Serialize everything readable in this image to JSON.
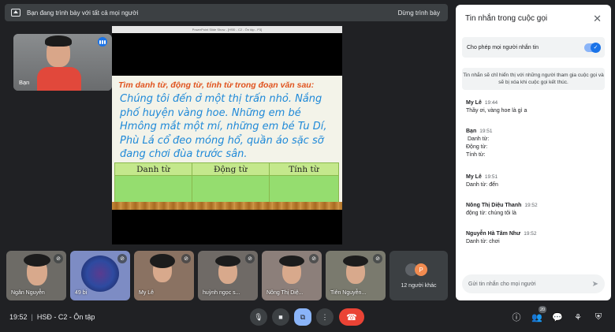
{
  "banner": {
    "text": "Bạn đang trình bày với tất cả mọi người",
    "stop_label": "Dừng trình bày"
  },
  "self_tile": {
    "name": "Bạn"
  },
  "presentation": {
    "window_title": "PowerPoint Slide Show - [HSĐ - C2 - Ôn tập - P3]",
    "question": "Tìm danh từ, động từ, tính từ trong đoạn văn sau:",
    "passage": "Chúng tôi đến ở một thị trấn nhỏ. Nắng phố huyện vàng hoe. Những em bé Hmông mắt một mí, những em bé Tu Dí, Phù Lá cổ đeo móng hổ, quần áo sặc sỡ đang chơi đùa trước sân.",
    "table_headers": [
      "Danh từ",
      "Động từ",
      "Tính từ"
    ]
  },
  "chat": {
    "title": "Tin nhắn trong cuộc gọi",
    "allow_label": "Cho phép mọi người nhắn tin",
    "allow_enabled": true,
    "notice": "Tin nhắn sẽ chỉ hiển thị với những người tham gia cuộc gọi và sẽ bị xóa khi cuộc gọi kết thúc.",
    "messages": [
      {
        "sender": "My Lê",
        "time": "19:44",
        "lines": [
          "Thầy ơi, vàng hoe là gì a"
        ]
      },
      {
        "sender": "Bạn",
        "time": "19:51",
        "lines": [
          "Danh từ:",
          "Động từ:",
          "Tính từ:"
        ]
      },
      {
        "sender": "My Lê",
        "time": "19:51",
        "lines": [
          "Danh từ: đến"
        ]
      },
      {
        "sender": "Nông Thị Diệu Thanh",
        "time": "19:52",
        "lines": [
          "động từ: chúng tôi là"
        ]
      },
      {
        "sender": "Nguyễn Hà Tâm Như",
        "time": "19:52",
        "lines": [
          "Danh từ: chơi"
        ]
      }
    ],
    "input_placeholder": "Gửi tin nhắn cho mọi người"
  },
  "participants": [
    {
      "name": "Ngân Nguyễn"
    },
    {
      "name": "49 bi"
    },
    {
      "name": "My Lê"
    },
    {
      "name": "huỳnh ngọc s..."
    },
    {
      "name": "Nông Thị Diệ..."
    },
    {
      "name": "Tiên Nguyễn..."
    }
  ],
  "more_participants": {
    "label": "12 người khác",
    "avatar_letter": "P"
  },
  "bottom_bar": {
    "time": "19:52",
    "meeting_name": "HSĐ - C2 - Ôn tập",
    "participant_count": "20"
  },
  "colors": {
    "accent": "#1a73e8",
    "end_call": "#ea4335",
    "slide_question": "#e0531e",
    "slide_text": "#1f89d8",
    "table_fill": "#95dd6f"
  }
}
